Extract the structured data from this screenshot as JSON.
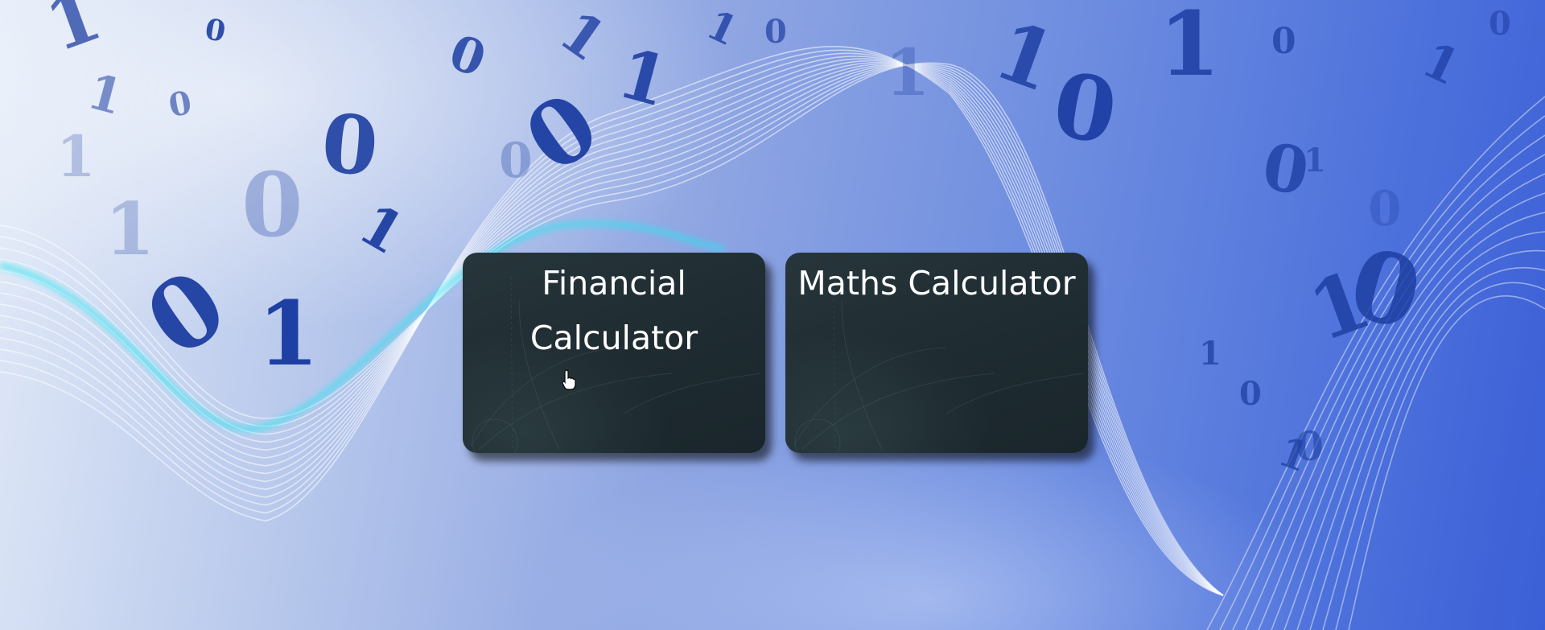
{
  "tiles": [
    {
      "label": "Financial Calculator"
    },
    {
      "label": "Maths Calculator"
    }
  ],
  "background": {
    "digits": [
      "1",
      "0",
      "1",
      "0",
      "0",
      "1",
      "0",
      "1",
      "0",
      "1",
      "1",
      "0",
      "1",
      "0",
      "1",
      "0",
      "1",
      "0",
      "1",
      "0",
      "0",
      "1",
      "1",
      "0",
      "1",
      "0",
      "1",
      "0",
      "0",
      "1",
      "1",
      "0",
      "1",
      "0"
    ],
    "colors": {
      "digit": "#1e3fa3",
      "wave": "#ffffff",
      "wave_glow": "#27e6f0",
      "tile": "#1f2d32"
    }
  }
}
